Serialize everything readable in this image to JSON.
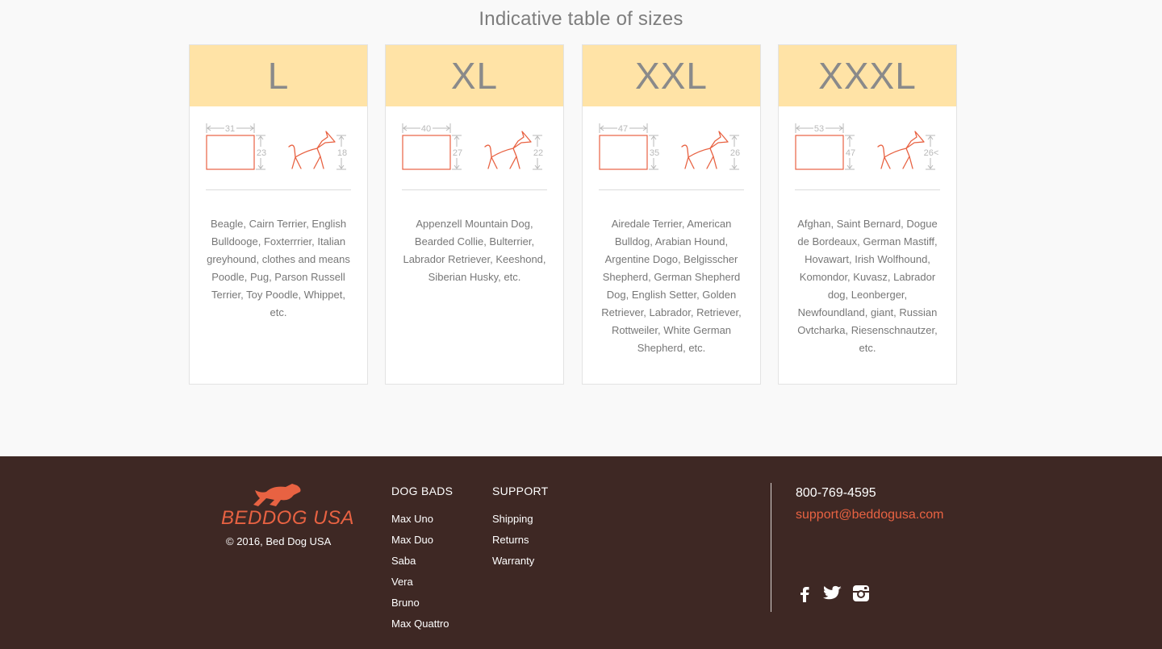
{
  "page_title": "Indicative table of sizes",
  "sizes": [
    {
      "label": "L",
      "width": "31",
      "depth": "23",
      "dog_height": "18",
      "breeds": "Beagle, Cairn Terrier, English Bulldooge, Foxterrrier, Italian greyhound, clothes and means Poodle, Pug, Parson Russell Terrier, Toy Poodle, Whippet, etc."
    },
    {
      "label": "XL",
      "width": "40",
      "depth": "27",
      "dog_height": "22",
      "breeds": "Appenzell Mountain Dog, Bearded Collie, Bulterrier, Labrador Retriever, Keeshond, Siberian Husky, etc."
    },
    {
      "label": "XXL",
      "width": "47",
      "depth": "35",
      "dog_height": "26",
      "breeds": "Airedale Terrier, American Bulldog, Arabian Hound, Argentine Dogo, Belgisscher Shepherd, German Shepherd Dog, English Setter, Golden Retriever, Labrador, Retriever, Rottweiler, White German Shepherd, etc."
    },
    {
      "label": "XXXL",
      "width": "53",
      "depth": "47",
      "dog_height": "26<",
      "breeds": "Afghan, Saint Bernard, Dogue de Bordeaux, German Mastiff, Hovawart, Irish Wolfhound, Komondor, Kuvasz, Labrador dog, Leonberger, Newfoundland, giant, Russian Ovtcharka, Riesenschnautzer, etc."
    }
  ],
  "footer": {
    "logo_text": "BEDDOG USA",
    "copyright": "© 2016, Bed Dog USA",
    "dog_bads": {
      "title": "DOG BADS",
      "links": [
        "Max Uno",
        "Max Duo",
        "Saba",
        "Vera",
        "Bruno",
        "Max Quattro"
      ]
    },
    "support": {
      "title": "SUPPORT",
      "links": [
        "Shipping",
        "Returns",
        "Warranty"
      ]
    },
    "phone": "800-769-4595",
    "email": "support@beddogusa.com",
    "social_icons": [
      "facebook-icon",
      "twitter-icon",
      "instagram-icon"
    ]
  },
  "colors": {
    "accent": "#e86242",
    "card_header": "#ffe3a6",
    "footer_bg": "#3e2824"
  }
}
